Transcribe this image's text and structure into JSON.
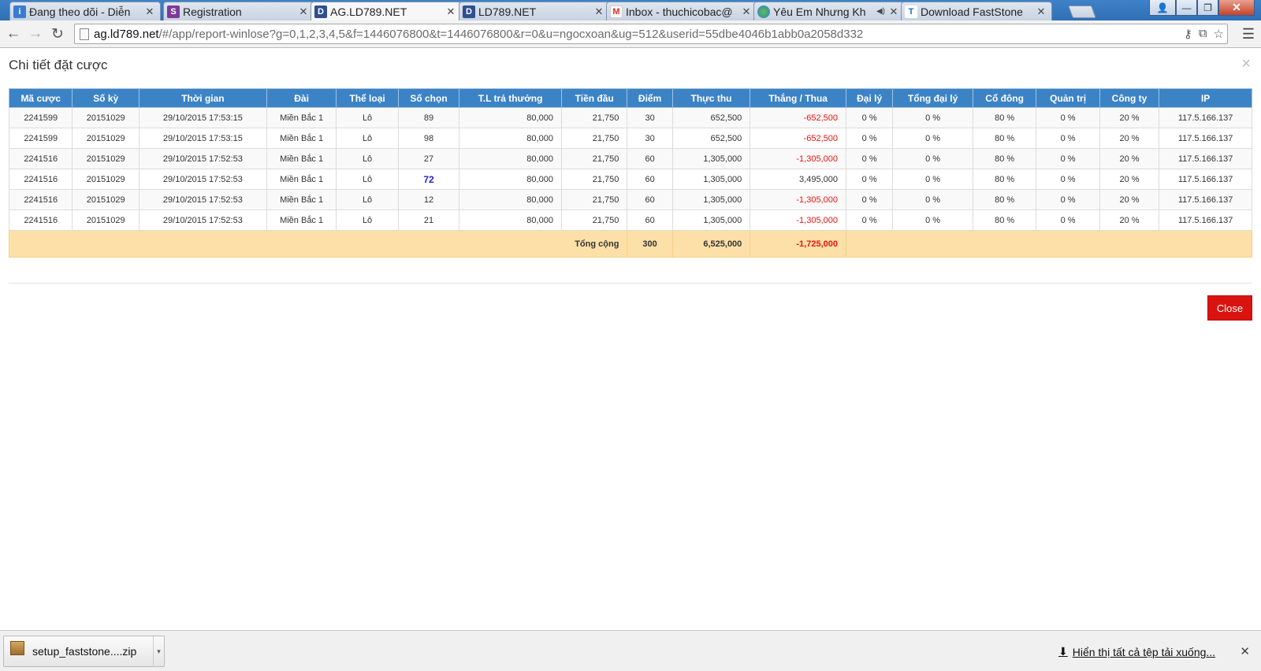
{
  "browser": {
    "tabs": [
      {
        "title": "Đang theo dõi - Diễn",
        "favicon": "forum-icon",
        "active": false
      },
      {
        "title": "Registration",
        "favicon": "s-logo-icon",
        "active": false
      },
      {
        "title": "AG.LD789.NET",
        "favicon": "ld-logo-icon",
        "active": true
      },
      {
        "title": "LD789.NET",
        "favicon": "ld-logo-icon",
        "active": false
      },
      {
        "title": "Inbox - thuchicobac@",
        "favicon": "gmail-icon",
        "active": false
      },
      {
        "title": "Yêu Em Nhưng Kh",
        "favicon": "music-icon",
        "active": false
      },
      {
        "title": "Download FastStone",
        "favicon": "t-logo-icon",
        "active": false
      }
    ],
    "url_host": "ag.ld789.net",
    "url_rest": "/#/app/report-winlose?g=0,1,2,3,4,5&f=1446076800&t=1446076800&r=0&u=ngocxoan&ug=512&userid=55dbe4046b1abb0a2058d332"
  },
  "modal": {
    "title": "Chi tiết đặt cược",
    "close_label": "Close",
    "columns": [
      "Mã cược",
      "Số kỳ",
      "Thời gian",
      "Đài",
      "Thể loại",
      "Số chọn",
      "T.L trả thưởng",
      "Tiền đầu",
      "Điểm",
      "Thực thu",
      "Thắng / Thua",
      "Đại lý",
      "Tổng đại lý",
      "Cổ đông",
      "Quản trị",
      "Công ty",
      "IP"
    ],
    "rows": [
      [
        "2241599",
        "20151029",
        "29/10/2015 17:53:15",
        "Miền Bắc 1",
        "Lô",
        "89",
        "80,000",
        "21,750",
        "30",
        "652,500",
        "-652,500",
        "0 %",
        "0 %",
        "80 %",
        "0 %",
        "20 %",
        "117.5.166.137"
      ],
      [
        "2241599",
        "20151029",
        "29/10/2015 17:53:15",
        "Miền Bắc 1",
        "Lô",
        "98",
        "80,000",
        "21,750",
        "30",
        "652,500",
        "-652,500",
        "0 %",
        "0 %",
        "80 %",
        "0 %",
        "20 %",
        "117.5.166.137"
      ],
      [
        "2241516",
        "20151029",
        "29/10/2015 17:52:53",
        "Miền Bắc 1",
        "Lô",
        "27",
        "80,000",
        "21,750",
        "60",
        "1,305,000",
        "-1,305,000",
        "0 %",
        "0 %",
        "80 %",
        "0 %",
        "20 %",
        "117.5.166.137"
      ],
      [
        "2241516",
        "20151029",
        "29/10/2015 17:52:53",
        "Miền Bắc 1",
        "Lô",
        "72",
        "80,000",
        "21,750",
        "60",
        "1,305,000",
        "3,495,000",
        "0 %",
        "0 %",
        "80 %",
        "0 %",
        "20 %",
        "117.5.166.137"
      ],
      [
        "2241516",
        "20151029",
        "29/10/2015 17:52:53",
        "Miền Bắc 1",
        "Lô",
        "12",
        "80,000",
        "21,750",
        "60",
        "1,305,000",
        "-1,305,000",
        "0 %",
        "0 %",
        "80 %",
        "0 %",
        "20 %",
        "117.5.166.137"
      ],
      [
        "2241516",
        "20151029",
        "29/10/2015 17:52:53",
        "Miền Bắc 1",
        "Lô",
        "21",
        "80,000",
        "21,750",
        "60",
        "1,305,000",
        "-1,305,000",
        "0 %",
        "0 %",
        "80 %",
        "0 %",
        "20 %",
        "117.5.166.137"
      ]
    ],
    "highlighted_row": 3,
    "totals": {
      "label": "Tổng cộng",
      "diem": "300",
      "thuc_thu": "6,525,000",
      "thang_thua": "-1,725,000"
    }
  },
  "downloads": {
    "file_name": "setup_faststone....zip",
    "show_all_label": "Hiển thị tất cả tệp tải xuống..."
  },
  "colors": {
    "header_bg": "#3c83c6",
    "negative": "#e8140f",
    "highlight_number": "#2323d8",
    "total_row_bg": "#fde0a8",
    "close_button": "#d9130f"
  }
}
